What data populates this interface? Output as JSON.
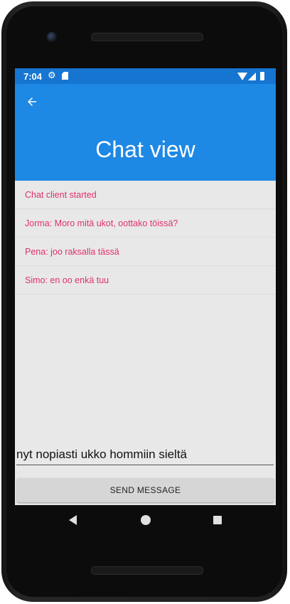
{
  "status_bar": {
    "time": "7:04",
    "icons": [
      "gear-icon",
      "sd-card-icon",
      "wifi-icon",
      "signal-icon",
      "battery-icon"
    ]
  },
  "toolbar": {
    "back_icon": "arrow-left-icon",
    "title": "Chat view"
  },
  "messages": [
    "Chat client started",
    "Jorma: Moro mitä ukot, oottako töissä?",
    "Pena: joo raksalla tässä",
    "Simo: en oo enkä tuu"
  ],
  "composer": {
    "value": "nyt nopiasti ukko hommiin sieltä",
    "send_label": "SEND MESSAGE"
  },
  "nav_bar": {
    "icons": [
      "back-triangle-icon",
      "home-circle-icon",
      "recents-square-icon"
    ]
  },
  "colors": {
    "status_bar": "#1675d1",
    "toolbar": "#1e88e5",
    "message_text": "#e0306e",
    "background": "#e8e8e8"
  }
}
